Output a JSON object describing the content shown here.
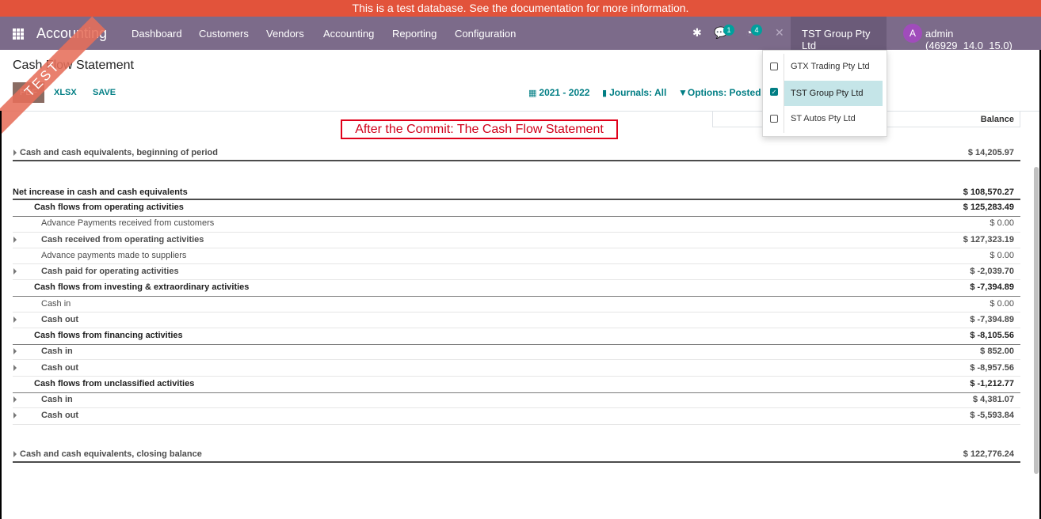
{
  "banner": {
    "text": "This is a test database.",
    "link": "See the documentation for more information."
  },
  "navbar": {
    "brand": "Accounting",
    "menu": [
      "Dashboard",
      "Customers",
      "Vendors",
      "Accounting",
      "Reporting",
      "Configuration"
    ],
    "messages_badge": "1",
    "activities_badge": "4",
    "company": "TST Group Pty Ltd",
    "avatar_letter": "A",
    "user": "admin (46929_14.0_15.0)"
  },
  "ribbon": "TEST",
  "report": {
    "title": "Cash Flow Statement",
    "buttons": {
      "pdf": "PDF",
      "xlsx": "XLSX",
      "save": "SAVE"
    },
    "filters": {
      "date": "2021 - 2022",
      "journals": "Journals: All",
      "options": "Options: Posted Entries"
    },
    "balance_header": "Balance",
    "annotation": "After the Commit:  The Cash Flow Statement"
  },
  "rows": [
    {
      "label": "Cash and cash equivalents, beginning of period",
      "value": "$ 14,205.97"
    },
    {
      "label": "Net increase in cash and cash equivalents",
      "value": "$ 108,570.27"
    },
    {
      "label": "Cash flows from operating activities",
      "value": "$ 125,283.49"
    },
    {
      "label": "Advance Payments received from customers",
      "value": "$ 0.00"
    },
    {
      "label": "Cash received from operating activities",
      "value": "$ 127,323.19"
    },
    {
      "label": "Advance payments made to suppliers",
      "value": "$ 0.00"
    },
    {
      "label": "Cash paid for operating activities",
      "value": "$ -2,039.70"
    },
    {
      "label": "Cash flows from investing & extraordinary activities",
      "value": "$ -7,394.89"
    },
    {
      "label": "Cash in",
      "value": "$ 0.00"
    },
    {
      "label": "Cash out",
      "value": "$ -7,394.89"
    },
    {
      "label": "Cash flows from financing activities",
      "value": "$ -8,105.56"
    },
    {
      "label": "Cash in",
      "value": "$ 852.00"
    },
    {
      "label": "Cash out",
      "value": "$ -8,957.56"
    },
    {
      "label": "Cash flows from unclassified activities",
      "value": "$ -1,212.77"
    },
    {
      "label": "Cash in",
      "value": "$ 4,381.07"
    },
    {
      "label": "Cash out",
      "value": "$ -5,593.84"
    },
    {
      "label": "Cash and cash equivalents, closing balance",
      "value": "$ 122,776.24"
    }
  ],
  "company_dropdown": [
    {
      "name": "GTX Trading Pty Ltd",
      "checked": false
    },
    {
      "name": "TST Group Pty Ltd",
      "checked": true
    },
    {
      "name": "ST Autos Pty Ltd",
      "checked": false
    }
  ],
  "colors": {
    "navbar": "#7c6b8a",
    "banner": "#e2533b",
    "accent": "#017e84",
    "annotation": "#e0001a"
  }
}
